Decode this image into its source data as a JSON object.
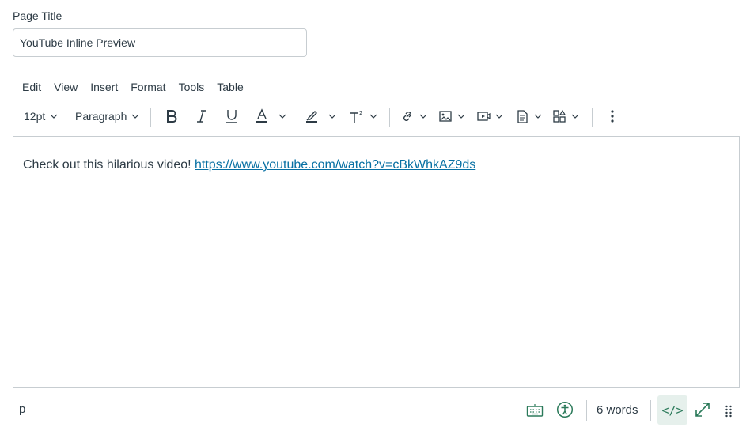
{
  "page_title": {
    "label": "Page Title",
    "value": "YouTube Inline Preview"
  },
  "menubar": {
    "items": [
      "Edit",
      "View",
      "Insert",
      "Format",
      "Tools",
      "Table"
    ]
  },
  "toolbar": {
    "font_size": "12pt",
    "block_format": "Paragraph",
    "icons": [
      "bold-icon",
      "italic-icon",
      "underline-icon",
      "text-color-icon",
      "highlight-icon",
      "superscript-icon",
      "link-icon",
      "image-icon",
      "media-icon",
      "document-icon",
      "apps-icon",
      "more-options-icon"
    ]
  },
  "editor": {
    "text": "Check out this hilarious video! ",
    "link": "https://www.youtube.com/watch?v=cBkWhkAZ9ds"
  },
  "statusbar": {
    "element_path": "p",
    "word_count": "6 words",
    "html_toggle": "</>"
  },
  "colors": {
    "text": "#2d3b45",
    "border": "#c7cdd1",
    "link": "#0770a3",
    "status_icon": "#2b7a5a",
    "active_bg": "#e6f0ec"
  }
}
